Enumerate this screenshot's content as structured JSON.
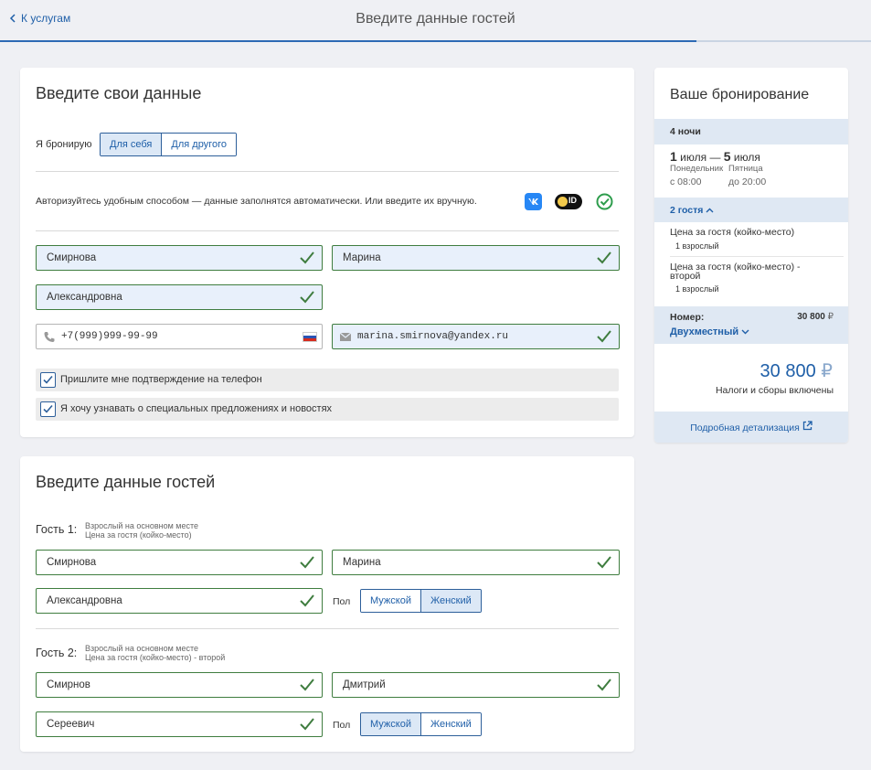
{
  "header": {
    "back_label": "К услугам",
    "title": "Введите данные гостей",
    "progress_fraction": 0.8
  },
  "own_data": {
    "title": "Введите свои данные",
    "booking_for_label": "Я бронирую",
    "booking_for_options": [
      "Для себя",
      "Для другого"
    ],
    "booking_for_selected": "Для себя",
    "auth_text": "Авторизуйтесь удобным способом — данные заполнятся автоматически. Или введите их вручную.",
    "auth_icons": [
      "vk-icon",
      "sber-id-icon",
      "gosuslugi-check-icon"
    ],
    "sber_id_text": "ID",
    "last_name": "Смирнова",
    "first_name": "Марина",
    "middle_name": "Александровна",
    "phone": "+7(999)999-99-99",
    "email": "marina.smirnova@yandex.ru",
    "checkbox_phone": "Пришлите мне подтверждение на телефон",
    "checkbox_news": "Я хочу узнавать о специальных предложениях и новостях"
  },
  "guests": {
    "title": "Введите данные гостей",
    "gender_label": "Пол",
    "gender_options": [
      "Мужской",
      "Женский"
    ],
    "list": [
      {
        "label": "Гость 1:",
        "note_line1": "Взрослый на основном месте",
        "note_line2": "Цена за гостя (койко-место)",
        "last_name": "Смирнова",
        "first_name": "Марина",
        "middle_name": "Александровна",
        "gender": "Женский"
      },
      {
        "label": "Гость 2:",
        "note_line1": "Взрослый на основном месте",
        "note_line2": "Цена за гостя (койко-место) - второй",
        "last_name": "Смирнов",
        "first_name": "Дмитрий",
        "middle_name": "Сереевич",
        "gender": "Мужской"
      }
    ]
  },
  "summary": {
    "title": "Ваше бронирование",
    "nights": "4 ночи",
    "checkin_day": "1",
    "checkin_month": "июля",
    "dash": "—",
    "checkout_day": "5",
    "checkout_month": "июля",
    "checkin_weekday": "Понедельник",
    "checkout_weekday": "Пятница",
    "checkin_time": "с 08:00",
    "checkout_time": "до 20:00",
    "guests_toggle": "2 гостя",
    "guest_rows": [
      {
        "title": "Цена за гостя (койко-место)",
        "sub": "1 взрослый"
      },
      {
        "title": "Цена за гостя (койко-место) -",
        "title2": "второй",
        "sub": "1 взрослый"
      }
    ],
    "room_label": "Номер:",
    "room_price": "30 800",
    "currency": "₽",
    "room_type": "Двухместный",
    "total": "30 800",
    "taxes_note": "Налоги и сборы включены",
    "details_link": "Подробная детализация"
  },
  "colors": {
    "accent": "#1f5fa8",
    "valid_green": "#3f7d3f",
    "active_segment": "#dce8f6",
    "filled_field": "#e8f0fb"
  }
}
